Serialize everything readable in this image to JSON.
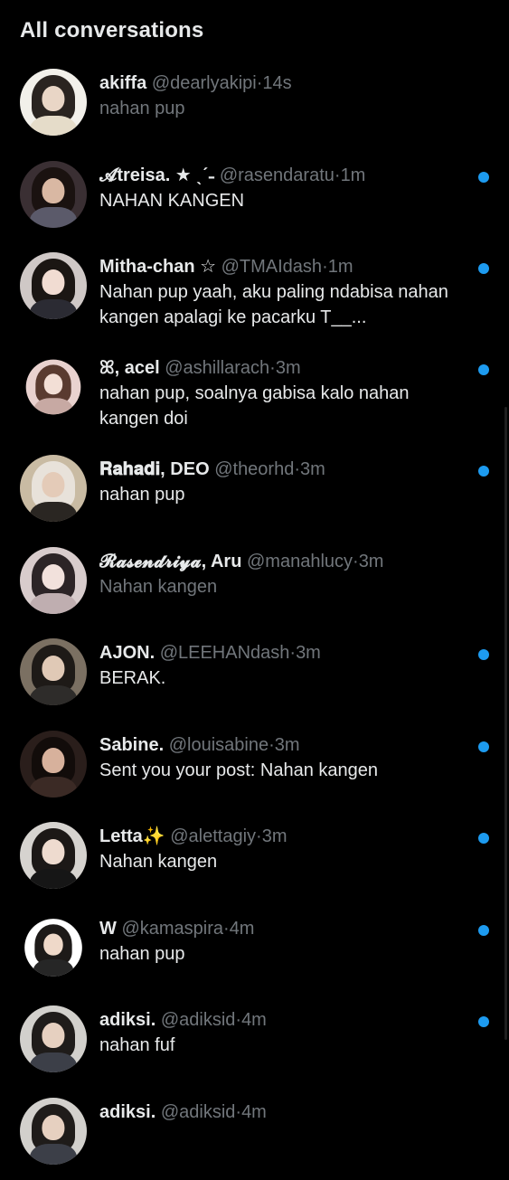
{
  "header": {
    "title": "All conversations"
  },
  "conversations": [
    {
      "name": "akiffa",
      "handle": "@dearlyakipi",
      "sep": "·",
      "time": "14s",
      "message": "nahan pup",
      "unread": false
    },
    {
      "name": "𝓐treisa. ★ ˎˊ˗",
      "handle": "@rasendaratu",
      "sep": "·",
      "time": "1m",
      "message": "NAHAN KANGEN",
      "unread": true
    },
    {
      "name": "Mitha-chan ☆",
      "handle": "@TMAIdash",
      "sep": "·",
      "time": "1m",
      "message": "Nahan pup yaah, aku paling ndabisa nahan kangen apalagi ke pacarku T__...",
      "unread": true
    },
    {
      "name": "ꕤ, acel",
      "handle": "@ashillarach",
      "sep": "·",
      "time": "3m",
      "message": "nahan pup, soalnya gabisa kalo nahan kangen doi",
      "unread": true
    },
    {
      "name": "𝐑𝐚𝐡𝐚𝐝𝐢, DEO",
      "handle": "@theorhd",
      "sep": "·",
      "time": "3m",
      "message": "nahan pup",
      "unread": true
    },
    {
      "name": "𝓡𝓪𝓼𝓮𝓷𝓭𝓻𝓲𝔂𝓪, Aru",
      "handle": "@manahlucy",
      "sep": "·",
      "time": "3m",
      "message": "Nahan kangen",
      "unread": false
    },
    {
      "name": "AJON.",
      "handle": "@LEEHANdash",
      "sep": "·",
      "time": "3m",
      "message": "BERAK.",
      "unread": true
    },
    {
      "name": "Sabine.",
      "handle": "@louisabine",
      "sep": "·",
      "time": "3m",
      "message": "Sent you your post: Nahan kangen",
      "unread": true
    },
    {
      "name": "Letta✨",
      "handle": "@alettagiy",
      "sep": "·",
      "time": "3m",
      "message": "Nahan kangen",
      "unread": true
    },
    {
      "name": "W",
      "handle": "@kamaspira",
      "sep": "·",
      "time": "4m",
      "message": "nahan pup",
      "unread": true
    },
    {
      "name": "adiksi.",
      "handle": "@adiksid",
      "sep": "·",
      "time": "4m",
      "message": "nahan fuf",
      "unread": true
    },
    {
      "name": "adiksi.",
      "handle": "@adiksid",
      "sep": "·",
      "time": "4m",
      "message": "",
      "unread": true
    }
  ],
  "colors": {
    "background": "#000000",
    "primary_text": "#e7e9ea",
    "secondary_text": "#71767b",
    "unread_dot": "#1d9bf0"
  }
}
